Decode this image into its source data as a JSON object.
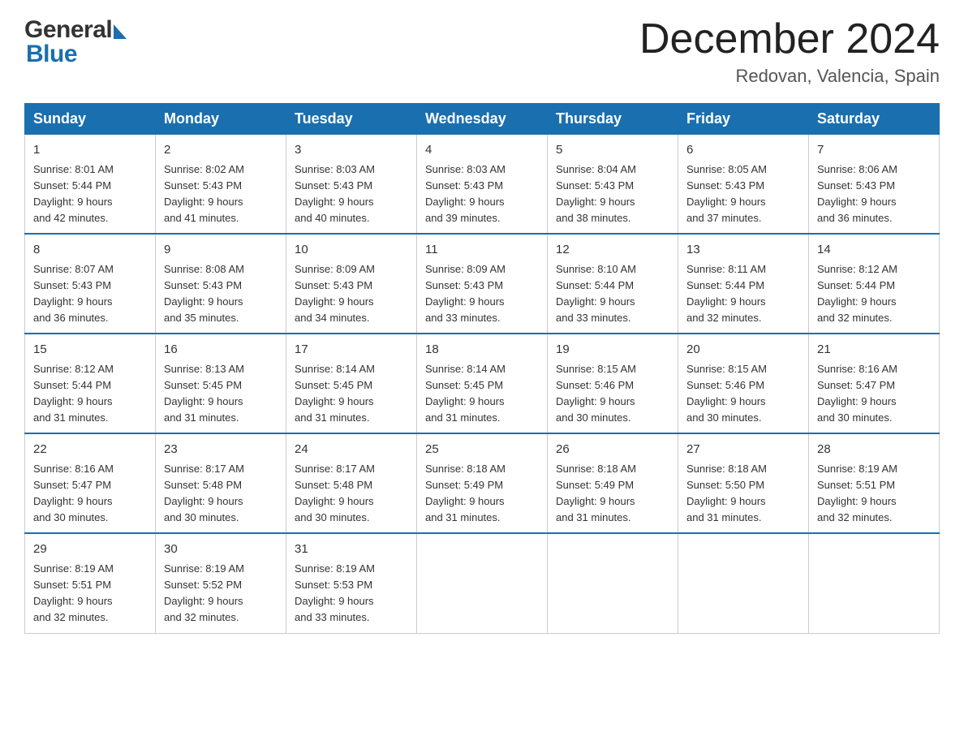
{
  "header": {
    "logo_general": "General",
    "logo_blue": "Blue",
    "month_title": "December 2024",
    "location": "Redovan, Valencia, Spain"
  },
  "calendar": {
    "days_of_week": [
      "Sunday",
      "Monday",
      "Tuesday",
      "Wednesday",
      "Thursday",
      "Friday",
      "Saturday"
    ],
    "weeks": [
      [
        {
          "date": "1",
          "sunrise": "8:01 AM",
          "sunset": "5:44 PM",
          "daylight": "9 hours and 42 minutes."
        },
        {
          "date": "2",
          "sunrise": "8:02 AM",
          "sunset": "5:43 PM",
          "daylight": "9 hours and 41 minutes."
        },
        {
          "date": "3",
          "sunrise": "8:03 AM",
          "sunset": "5:43 PM",
          "daylight": "9 hours and 40 minutes."
        },
        {
          "date": "4",
          "sunrise": "8:03 AM",
          "sunset": "5:43 PM",
          "daylight": "9 hours and 39 minutes."
        },
        {
          "date": "5",
          "sunrise": "8:04 AM",
          "sunset": "5:43 PM",
          "daylight": "9 hours and 38 minutes."
        },
        {
          "date": "6",
          "sunrise": "8:05 AM",
          "sunset": "5:43 PM",
          "daylight": "9 hours and 37 minutes."
        },
        {
          "date": "7",
          "sunrise": "8:06 AM",
          "sunset": "5:43 PM",
          "daylight": "9 hours and 36 minutes."
        }
      ],
      [
        {
          "date": "8",
          "sunrise": "8:07 AM",
          "sunset": "5:43 PM",
          "daylight": "9 hours and 36 minutes."
        },
        {
          "date": "9",
          "sunrise": "8:08 AM",
          "sunset": "5:43 PM",
          "daylight": "9 hours and 35 minutes."
        },
        {
          "date": "10",
          "sunrise": "8:09 AM",
          "sunset": "5:43 PM",
          "daylight": "9 hours and 34 minutes."
        },
        {
          "date": "11",
          "sunrise": "8:09 AM",
          "sunset": "5:43 PM",
          "daylight": "9 hours and 33 minutes."
        },
        {
          "date": "12",
          "sunrise": "8:10 AM",
          "sunset": "5:44 PM",
          "daylight": "9 hours and 33 minutes."
        },
        {
          "date": "13",
          "sunrise": "8:11 AM",
          "sunset": "5:44 PM",
          "daylight": "9 hours and 32 minutes."
        },
        {
          "date": "14",
          "sunrise": "8:12 AM",
          "sunset": "5:44 PM",
          "daylight": "9 hours and 32 minutes."
        }
      ],
      [
        {
          "date": "15",
          "sunrise": "8:12 AM",
          "sunset": "5:44 PM",
          "daylight": "9 hours and 31 minutes."
        },
        {
          "date": "16",
          "sunrise": "8:13 AM",
          "sunset": "5:45 PM",
          "daylight": "9 hours and 31 minutes."
        },
        {
          "date": "17",
          "sunrise": "8:14 AM",
          "sunset": "5:45 PM",
          "daylight": "9 hours and 31 minutes."
        },
        {
          "date": "18",
          "sunrise": "8:14 AM",
          "sunset": "5:45 PM",
          "daylight": "9 hours and 31 minutes."
        },
        {
          "date": "19",
          "sunrise": "8:15 AM",
          "sunset": "5:46 PM",
          "daylight": "9 hours and 30 minutes."
        },
        {
          "date": "20",
          "sunrise": "8:15 AM",
          "sunset": "5:46 PM",
          "daylight": "9 hours and 30 minutes."
        },
        {
          "date": "21",
          "sunrise": "8:16 AM",
          "sunset": "5:47 PM",
          "daylight": "9 hours and 30 minutes."
        }
      ],
      [
        {
          "date": "22",
          "sunrise": "8:16 AM",
          "sunset": "5:47 PM",
          "daylight": "9 hours and 30 minutes."
        },
        {
          "date": "23",
          "sunrise": "8:17 AM",
          "sunset": "5:48 PM",
          "daylight": "9 hours and 30 minutes."
        },
        {
          "date": "24",
          "sunrise": "8:17 AM",
          "sunset": "5:48 PM",
          "daylight": "9 hours and 30 minutes."
        },
        {
          "date": "25",
          "sunrise": "8:18 AM",
          "sunset": "5:49 PM",
          "daylight": "9 hours and 31 minutes."
        },
        {
          "date": "26",
          "sunrise": "8:18 AM",
          "sunset": "5:49 PM",
          "daylight": "9 hours and 31 minutes."
        },
        {
          "date": "27",
          "sunrise": "8:18 AM",
          "sunset": "5:50 PM",
          "daylight": "9 hours and 31 minutes."
        },
        {
          "date": "28",
          "sunrise": "8:19 AM",
          "sunset": "5:51 PM",
          "daylight": "9 hours and 32 minutes."
        }
      ],
      [
        {
          "date": "29",
          "sunrise": "8:19 AM",
          "sunset": "5:51 PM",
          "daylight": "9 hours and 32 minutes."
        },
        {
          "date": "30",
          "sunrise": "8:19 AM",
          "sunset": "5:52 PM",
          "daylight": "9 hours and 32 minutes."
        },
        {
          "date": "31",
          "sunrise": "8:19 AM",
          "sunset": "5:53 PM",
          "daylight": "9 hours and 33 minutes."
        },
        null,
        null,
        null,
        null
      ]
    ],
    "labels": {
      "sunrise": "Sunrise:",
      "sunset": "Sunset:",
      "daylight": "Daylight:"
    }
  }
}
